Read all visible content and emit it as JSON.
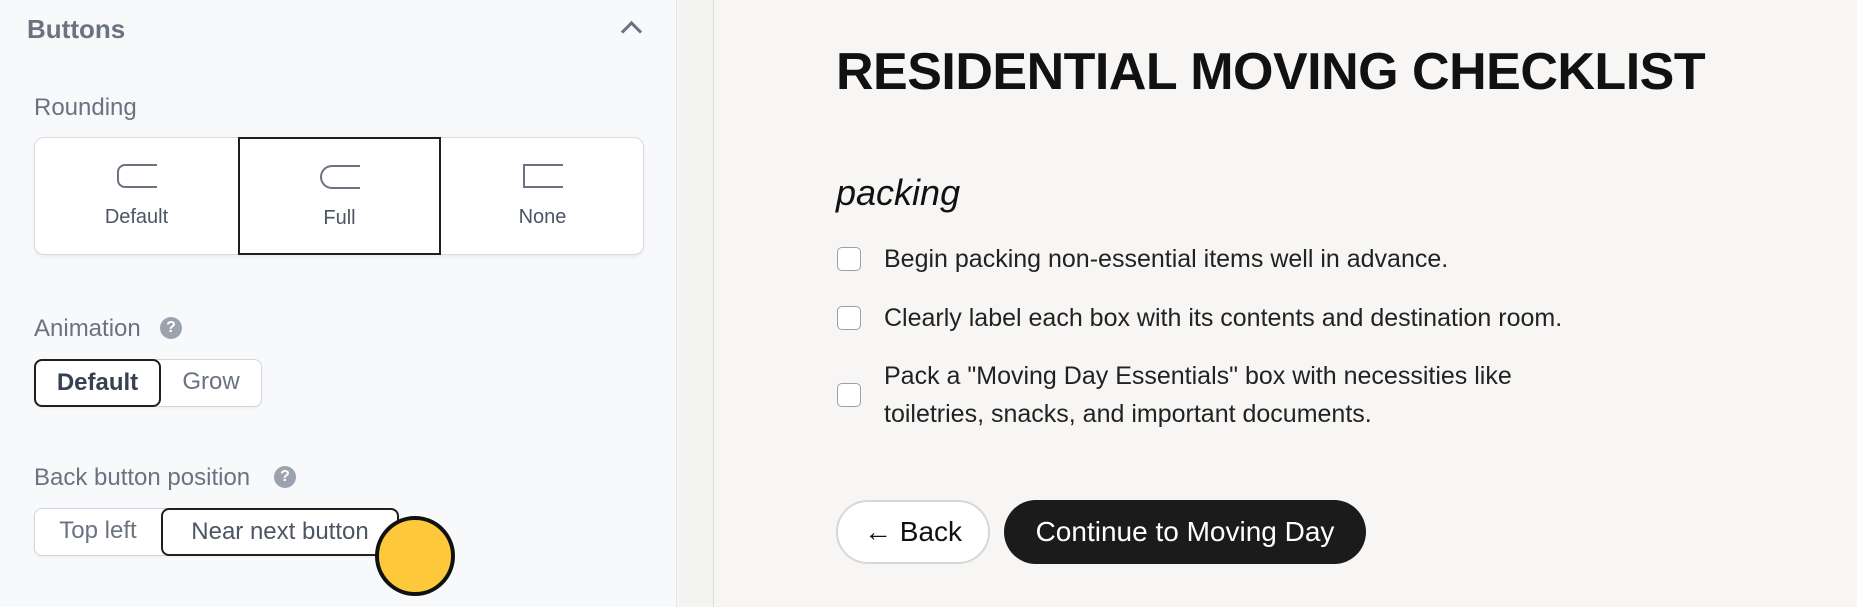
{
  "panel": {
    "section_title": "Buttons",
    "rounding": {
      "label": "Rounding",
      "options": [
        {
          "label": "Default"
        },
        {
          "label": "Full"
        },
        {
          "label": "None"
        }
      ],
      "selected": "Full"
    },
    "animation": {
      "label": "Animation",
      "options": [
        "Default",
        "Grow"
      ],
      "selected": "Default"
    },
    "back_button_position": {
      "label": "Back button position",
      "options": [
        "Top left",
        "Near next button"
      ],
      "selected": "Near next button"
    },
    "help_glyph": "?"
  },
  "preview": {
    "title": "RESIDENTIAL MOVING CHECKLIST",
    "subtitle": "packing",
    "items": [
      {
        "text": "Begin packing non-essential items well in advance.",
        "checked": false
      },
      {
        "text": "Clearly label each box with its contents and destination room.",
        "checked": false
      },
      {
        "text": "Pack a \"Moving Day Essentials\" box with necessities like toiletries, snacks, and important documents.",
        "checked": false
      }
    ],
    "back_label": "← Back",
    "next_label": "Continue to Moving Day"
  },
  "colors": {
    "accent_dark": "#1b1b1b",
    "cursor": "#fdc93a"
  }
}
